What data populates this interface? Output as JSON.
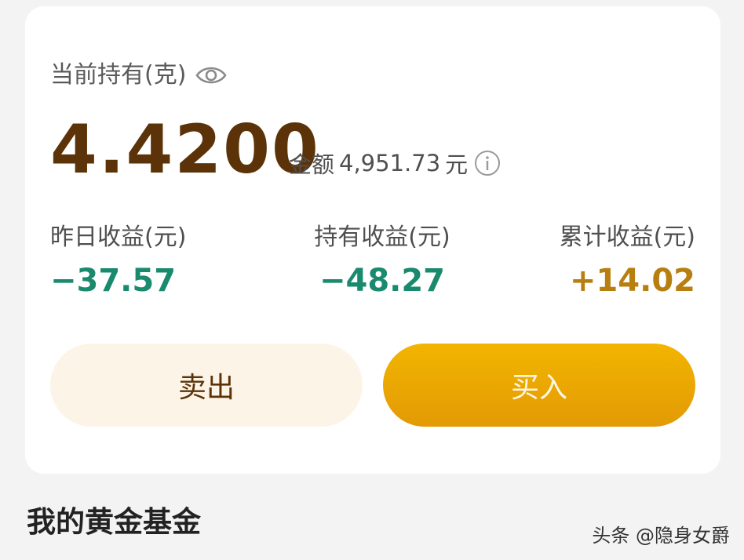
{
  "holding": {
    "label": "当前持有(克)",
    "value": "4.4200",
    "amount_label": "金额",
    "amount_value": "4,951.73",
    "amount_unit": "元"
  },
  "stats": {
    "yesterday": {
      "label": "昨日收益(元)",
      "value": "−37.57"
    },
    "holding": {
      "label": "持有收益(元)",
      "value": "−48.27"
    },
    "cumulative": {
      "label": "累计收益(元)",
      "value": "+14.02"
    }
  },
  "actions": {
    "sell_label": "卖出",
    "buy_label": "买入"
  },
  "section": {
    "title": "我的黄金基金"
  },
  "watermark": "头条 @隐身女爵",
  "icons": {
    "visibility": "eye-icon",
    "info": "info-icon"
  },
  "colors": {
    "holding_value": "#5c3308",
    "negative": "#1a8a6e",
    "positive": "#b77f10",
    "buy_button": "#f2b500",
    "sell_button_bg": "#fdf4e8"
  }
}
